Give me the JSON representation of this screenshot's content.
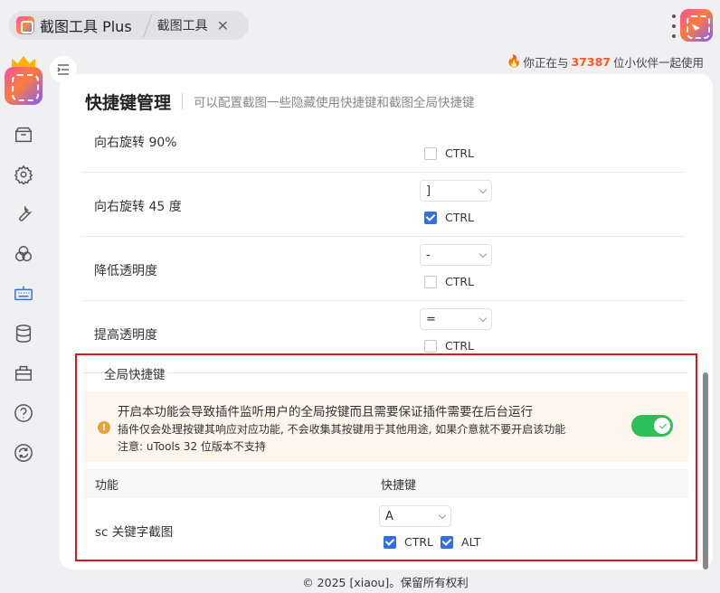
{
  "tabs": [
    {
      "label": "截图工具 Plus",
      "active": true
    },
    {
      "label": "截图工具",
      "closable": true
    }
  ],
  "usage": {
    "prefix": "你正在与",
    "count": "37387",
    "suffix": "位小伙伴一起使用"
  },
  "sidebar": {
    "icons": [
      "package-icon",
      "settings-icon",
      "wrench-icon",
      "color-circles-icon",
      "keyboard-icon",
      "database-icon",
      "toolbox-icon",
      "help-icon",
      "sync-icon"
    ],
    "active": "keyboard-icon"
  },
  "header": {
    "title": "快捷键管理",
    "description": "可以配置截图一些隐藏使用快捷键和截图全局快捷键"
  },
  "rows": [
    {
      "label": "向右旋转 90%",
      "key": null,
      "ctrl": false,
      "ctrl_label": "CTRL"
    },
    {
      "label": "向右旋转 45 度",
      "key": "]",
      "ctrl": true,
      "ctrl_label": "CTRL"
    },
    {
      "label": "降低透明度",
      "key": "-",
      "ctrl": false,
      "ctrl_label": "CTRL"
    },
    {
      "label": "提高透明度",
      "key": "=",
      "ctrl": false,
      "ctrl_label": "CTRL"
    }
  ],
  "global": {
    "legend": "全局快捷键",
    "warning": {
      "line1": "开启本功能会导致插件监听用户的全局按键而且需要保证插件需要在后台运行",
      "line2": "插件仅会处理按键其响应对应功能, 不会收集其按键用于其他用途, 如果介意就不要开启该功能",
      "line3": "注意: uTools 32 位版本不支持"
    },
    "enabled": true,
    "table_head": {
      "func": "功能",
      "shortcut": "快捷键"
    },
    "row": {
      "label": "sc 关键字截图",
      "key": "A",
      "ctrl_label": "CTRL",
      "ctrl": true,
      "alt_label": "ALT",
      "alt": true
    }
  },
  "footer": "© 2025 [xiaou]。保留所有权利"
}
